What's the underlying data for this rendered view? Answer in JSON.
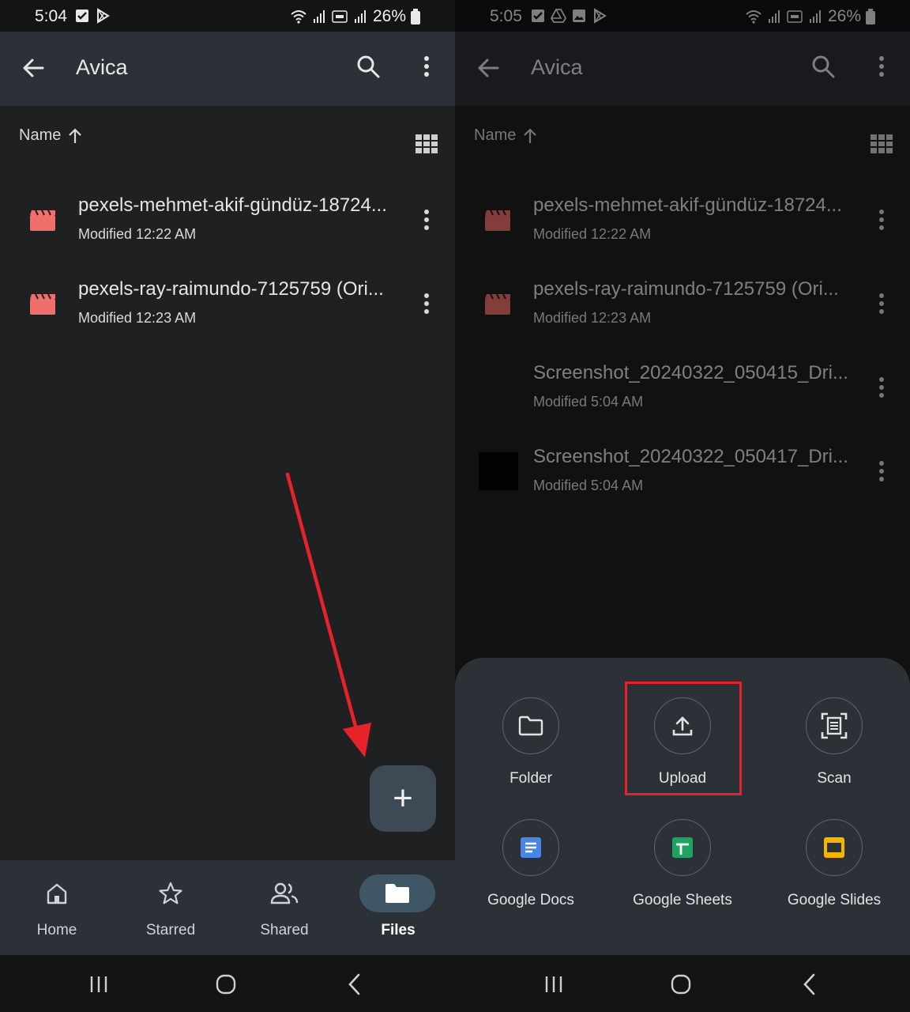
{
  "left": {
    "status": {
      "time": "5:04",
      "battery": "26%"
    },
    "appbar": {
      "title": "Avica"
    },
    "sort": {
      "label": "Name"
    },
    "files": [
      {
        "name": "pexels-mehmet-akif-gündüz-18724...",
        "modified": "Modified 12:22 AM",
        "type": "video"
      },
      {
        "name": "pexels-ray-raimundo-7125759 (Ori...",
        "modified": "Modified 12:23 AM",
        "type": "video"
      }
    ],
    "fab": {
      "label": "+"
    },
    "nav": [
      {
        "label": "Home",
        "icon": "home-icon"
      },
      {
        "label": "Starred",
        "icon": "star-icon"
      },
      {
        "label": "Shared",
        "icon": "shared-icon"
      },
      {
        "label": "Files",
        "icon": "folder-icon",
        "active": true
      }
    ]
  },
  "right": {
    "status": {
      "time": "5:05",
      "battery": "26%"
    },
    "appbar": {
      "title": "Avica"
    },
    "sort": {
      "label": "Name"
    },
    "files": [
      {
        "name": "pexels-mehmet-akif-gündüz-18724...",
        "modified": "Modified 12:22 AM",
        "type": "video"
      },
      {
        "name": "pexels-ray-raimundo-7125759 (Ori...",
        "modified": "Modified 12:23 AM",
        "type": "video"
      },
      {
        "name": "Screenshot_20240322_050415_Dri...",
        "modified": "Modified 5:04 AM",
        "type": "image"
      },
      {
        "name": "Screenshot_20240322_050417_Dri...",
        "modified": "Modified 5:04 AM",
        "type": "image"
      }
    ],
    "sheet": [
      {
        "label": "Folder",
        "icon": "folder-outline-icon"
      },
      {
        "label": "Upload",
        "icon": "upload-icon",
        "highlighted": true
      },
      {
        "label": "Scan",
        "icon": "scan-icon"
      },
      {
        "label": "Google Docs",
        "icon": "google-docs-icon"
      },
      {
        "label": "Google Sheets",
        "icon": "google-sheets-icon"
      },
      {
        "label": "Google Slides",
        "icon": "google-slides-icon"
      }
    ]
  },
  "colors": {
    "video_icon": "#ef6f6c",
    "highlight": "#e6222a",
    "arrow": "#e6222a",
    "docs": "#4a86e8",
    "sheets": "#1ea362",
    "slides": "#f4b400"
  }
}
